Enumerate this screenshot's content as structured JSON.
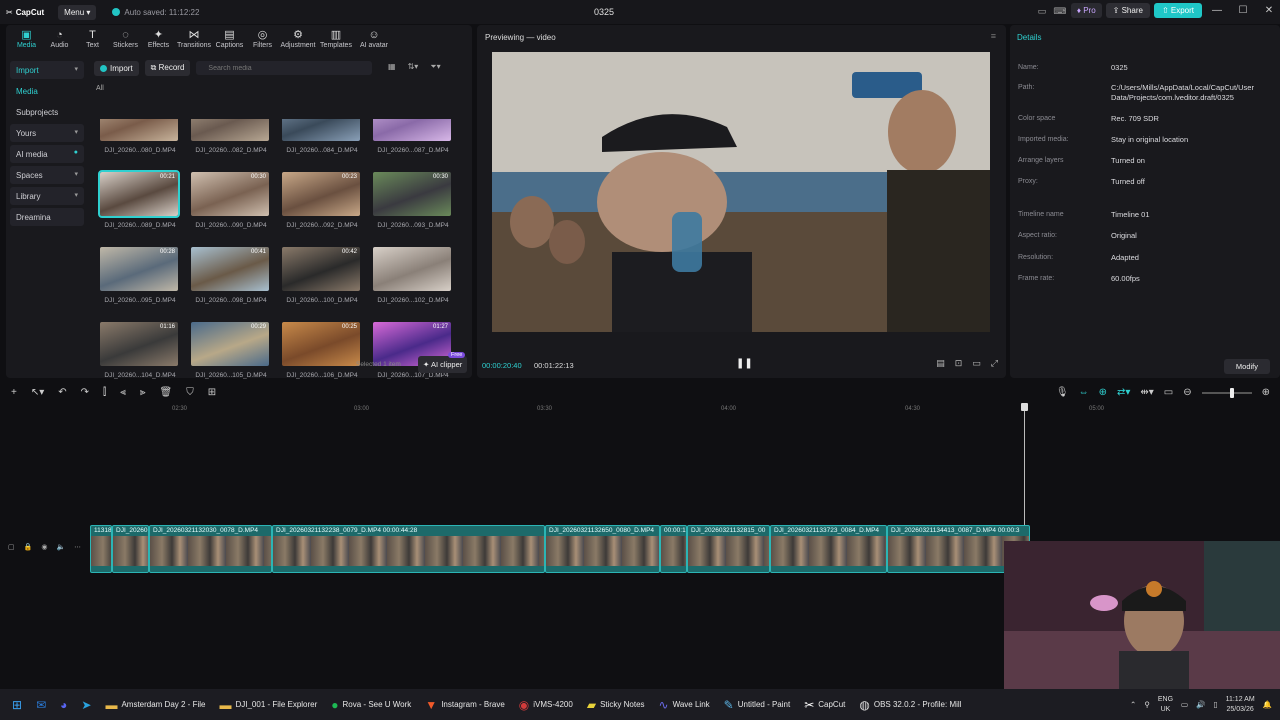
{
  "app": {
    "logo": "CapCut",
    "menu_label": "Menu",
    "autosave": "Auto saved: 11:12:22",
    "project_title": "0325",
    "pro_label": "Pro",
    "share_label": "Share",
    "export_label": "Export",
    "accent": "#2fd0d0"
  },
  "tool_tabs": [
    {
      "label": "Media",
      "icon": "media-icon"
    },
    {
      "label": "Audio",
      "icon": "audio-icon"
    },
    {
      "label": "Text",
      "icon": "text-icon"
    },
    {
      "label": "Stickers",
      "icon": "stickers-icon"
    },
    {
      "label": "Effects",
      "icon": "effects-icon"
    },
    {
      "label": "Transitions",
      "icon": "transitions-icon"
    },
    {
      "label": "Captions",
      "icon": "captions-icon"
    },
    {
      "label": "Filters",
      "icon": "filters-icon"
    },
    {
      "label": "Adjustment",
      "icon": "adjustment-icon"
    },
    {
      "label": "Templates",
      "icon": "templates-icon"
    },
    {
      "label": "AI avatar",
      "icon": "ai-avatar-icon"
    }
  ],
  "side_nav": [
    "Import",
    "Media",
    "Subprojects",
    "Yours",
    "AI media",
    "Spaces",
    "Library",
    "Dreamina"
  ],
  "media": {
    "import_label": "Import",
    "record_label": "Record",
    "search_placeholder": "Search media",
    "all_label": "All",
    "selected_text": "Selected 1 item",
    "ai_clipper": "AI clipper",
    "free_badge": "Free",
    "clips": [
      {
        "name": "DJI_20260...080_D.MP4",
        "dur": ""
      },
      {
        "name": "DJI_20260...082_D.MP4",
        "dur": ""
      },
      {
        "name": "DJI_20260...084_D.MP4",
        "dur": ""
      },
      {
        "name": "DJI_20260...087_D.MP4",
        "dur": ""
      },
      {
        "name": "DJI_20260...089_D.MP4",
        "dur": "00:21"
      },
      {
        "name": "DJI_20260...090_D.MP4",
        "dur": "00:30"
      },
      {
        "name": "DJI_20260...092_D.MP4",
        "dur": "00:23"
      },
      {
        "name": "DJI_20260...093_D.MP4",
        "dur": "00:30"
      },
      {
        "name": "DJI_20260...095_D.MP4",
        "dur": "00:28"
      },
      {
        "name": "DJI_20260...098_D.MP4",
        "dur": "00:41"
      },
      {
        "name": "DJI_20260...100_D.MP4",
        "dur": "00:42"
      },
      {
        "name": "DJI_20260...102_D.MP4",
        "dur": ""
      },
      {
        "name": "DJI_20260...104_D.MP4",
        "dur": "01:16"
      },
      {
        "name": "DJI_20260...105_D.MP4",
        "dur": "00:29"
      },
      {
        "name": "DJI_20260...106_D.MP4",
        "dur": "00:25"
      },
      {
        "name": "DJI_20260...107_D.MP4",
        "dur": "01:27"
      }
    ]
  },
  "preview": {
    "title": "Previewing — video",
    "time_current": "00:00:20:40",
    "time_total": "00:01:22:13"
  },
  "details": {
    "title": "Details",
    "rows": [
      {
        "label": "Name:",
        "value": "0325"
      },
      {
        "label": "Path:",
        "value": "C:/Users/Mills/AppData/Local/CapCut/User Data/Projects/com.lveditor.draft/0325"
      },
      {
        "label": "Color space",
        "value": "Rec. 709 SDR"
      },
      {
        "label": "Imported media:",
        "value": "Stay in original location"
      },
      {
        "label": "Arrange layers",
        "value": "Turned on"
      },
      {
        "label": "Proxy:",
        "value": "Turned off"
      },
      {
        "label": "Timeline name",
        "value": "Timeline 01"
      },
      {
        "label": "Aspect ratio:",
        "value": "Original"
      },
      {
        "label": "Resolution:",
        "value": "Adapted"
      },
      {
        "label": "Frame rate:",
        "value": "60.00fps"
      }
    ],
    "modify_label": "Modify"
  },
  "timeline": {
    "ticks": [
      "02:30",
      "03:00",
      "03:30",
      "04:00",
      "04:30",
      "05:00"
    ],
    "segments": [
      {
        "label": "1131829"
      },
      {
        "label": "DJI_20260"
      },
      {
        "label": "DJI_20260321132030_0078_D.MP4"
      },
      {
        "label": "DJI_20260321132238_0079_D.MP4  00:00:44:28"
      },
      {
        "label": "DJI_20260321132650_0080_D.MP4"
      },
      {
        "label": "00:00:1"
      },
      {
        "label": "DJI_20260321132815_00"
      },
      {
        "label": "DJI_20260321133723_0084_D.MP4"
      },
      {
        "label": "DJI_20260321134413_0087_D.MP4  00:00:3"
      }
    ]
  },
  "taskbar": {
    "apps": [
      {
        "label": "",
        "icon": "windows-icon"
      },
      {
        "label": "",
        "icon": "outlook-icon"
      },
      {
        "label": "",
        "icon": "discord-icon"
      },
      {
        "label": "",
        "icon": "telegram-icon"
      },
      {
        "label": "Amsterdam Day 2 - File",
        "icon": "folder-icon"
      },
      {
        "label": "DJI_001 - File Explorer",
        "icon": "folder-icon"
      },
      {
        "label": "Rova - See U Work",
        "icon": "spotify-icon"
      },
      {
        "label": "Instagram - Brave",
        "icon": "brave-icon"
      },
      {
        "label": "iVMS-4200",
        "icon": "ivms-icon"
      },
      {
        "label": "Sticky Notes",
        "icon": "sticky-notes-icon"
      },
      {
        "label": "Wave Link",
        "icon": "wave-link-icon"
      },
      {
        "label": "Untitled - Paint",
        "icon": "paint-icon"
      },
      {
        "label": "CapCut",
        "icon": "capcut-icon"
      },
      {
        "label": "OBS 32.0.2 - Profile: Mill",
        "icon": "obs-icon"
      }
    ],
    "lang_top": "ENG",
    "lang_bottom": "UK",
    "time": "11:12 AM",
    "date": "25/03/26"
  }
}
